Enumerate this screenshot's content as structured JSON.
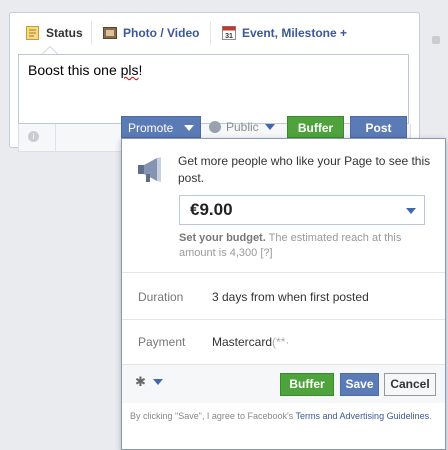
{
  "tabs": [
    {
      "label": "Status",
      "icon": "status-icon"
    },
    {
      "label": "Photo / Video",
      "icon": "photo-icon"
    },
    {
      "label": "Event, Milestone +",
      "icon": "calendar-icon",
      "icon_text": "31"
    }
  ],
  "composer": {
    "text_before": "Boost this one ",
    "text_misspelled": "pls",
    "text_after": "!"
  },
  "toolbar": {
    "promote_label": "Promote",
    "privacy_label": "Public",
    "buffer_label": "Buffer",
    "post_label": "Post"
  },
  "promote_panel": {
    "headline": "Get more people who like your Page to see this post.",
    "budget_value": "€9.00",
    "reach_bold": "Set your budget.",
    "reach_text": "The estimated reach at this amount is 4,300",
    "reach_help": "[?]",
    "duration_label": "Duration",
    "duration_value": "3 days from when first posted",
    "payment_label": "Payment",
    "payment_value": "Mastercard",
    "payment_masked": "(**·",
    "buffer_label": "Buffer",
    "save_label": "Save",
    "cancel_label": "Cancel",
    "terms_prefix": "By clicking \"Save\", I agree to Facebook's",
    "terms_link": "Terms and Advertising Guidelines",
    "terms_suffix": "."
  },
  "colors": {
    "facebook_blue": "#5b7bb6",
    "buffer_green": "#4ea33d",
    "link_blue": "#3b5998"
  }
}
